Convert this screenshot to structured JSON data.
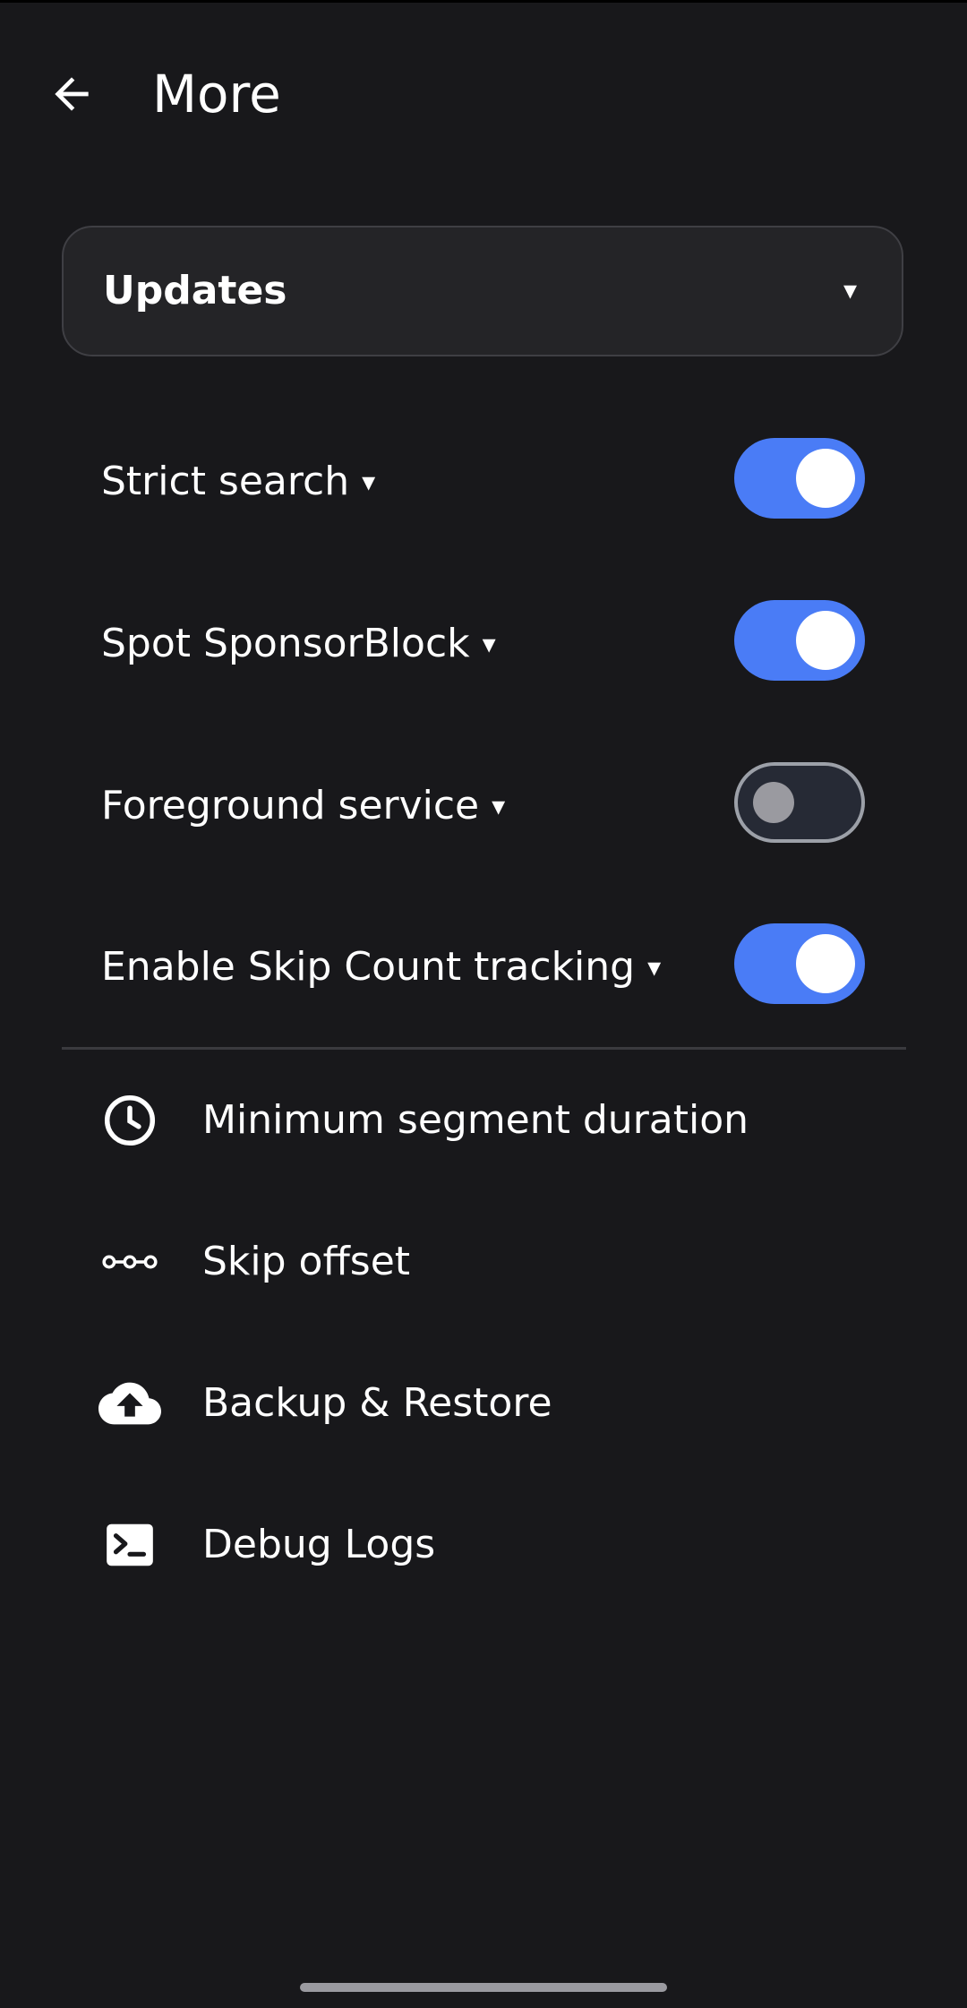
{
  "appbar": {
    "title": "More",
    "back_icon": "arrow-left-icon"
  },
  "dropdown": {
    "label": "Updates",
    "caret": "▾"
  },
  "toggles": [
    {
      "label": "Strict search",
      "caret": "▾",
      "state": "on"
    },
    {
      "label": "Spot SponsorBlock",
      "caret": "▾",
      "state": "on"
    },
    {
      "label": "Foreground service",
      "caret": "▾",
      "state": "off"
    },
    {
      "label": "Enable Skip Count tracking",
      "caret": "▾",
      "state": "on"
    }
  ],
  "menu": [
    {
      "label": "Minimum segment duration",
      "icon": "clock-icon"
    },
    {
      "label": "Skip offset",
      "icon": "dots-line-icon"
    },
    {
      "label": "Backup & Restore",
      "icon": "cloud-upload-icon"
    },
    {
      "label": "Debug Logs",
      "icon": "terminal-icon"
    }
  ],
  "colors": {
    "background": "#18181b",
    "accent": "#4a7cf6",
    "dropdown_bg": "#242427",
    "divider": "#3a3a3f"
  }
}
